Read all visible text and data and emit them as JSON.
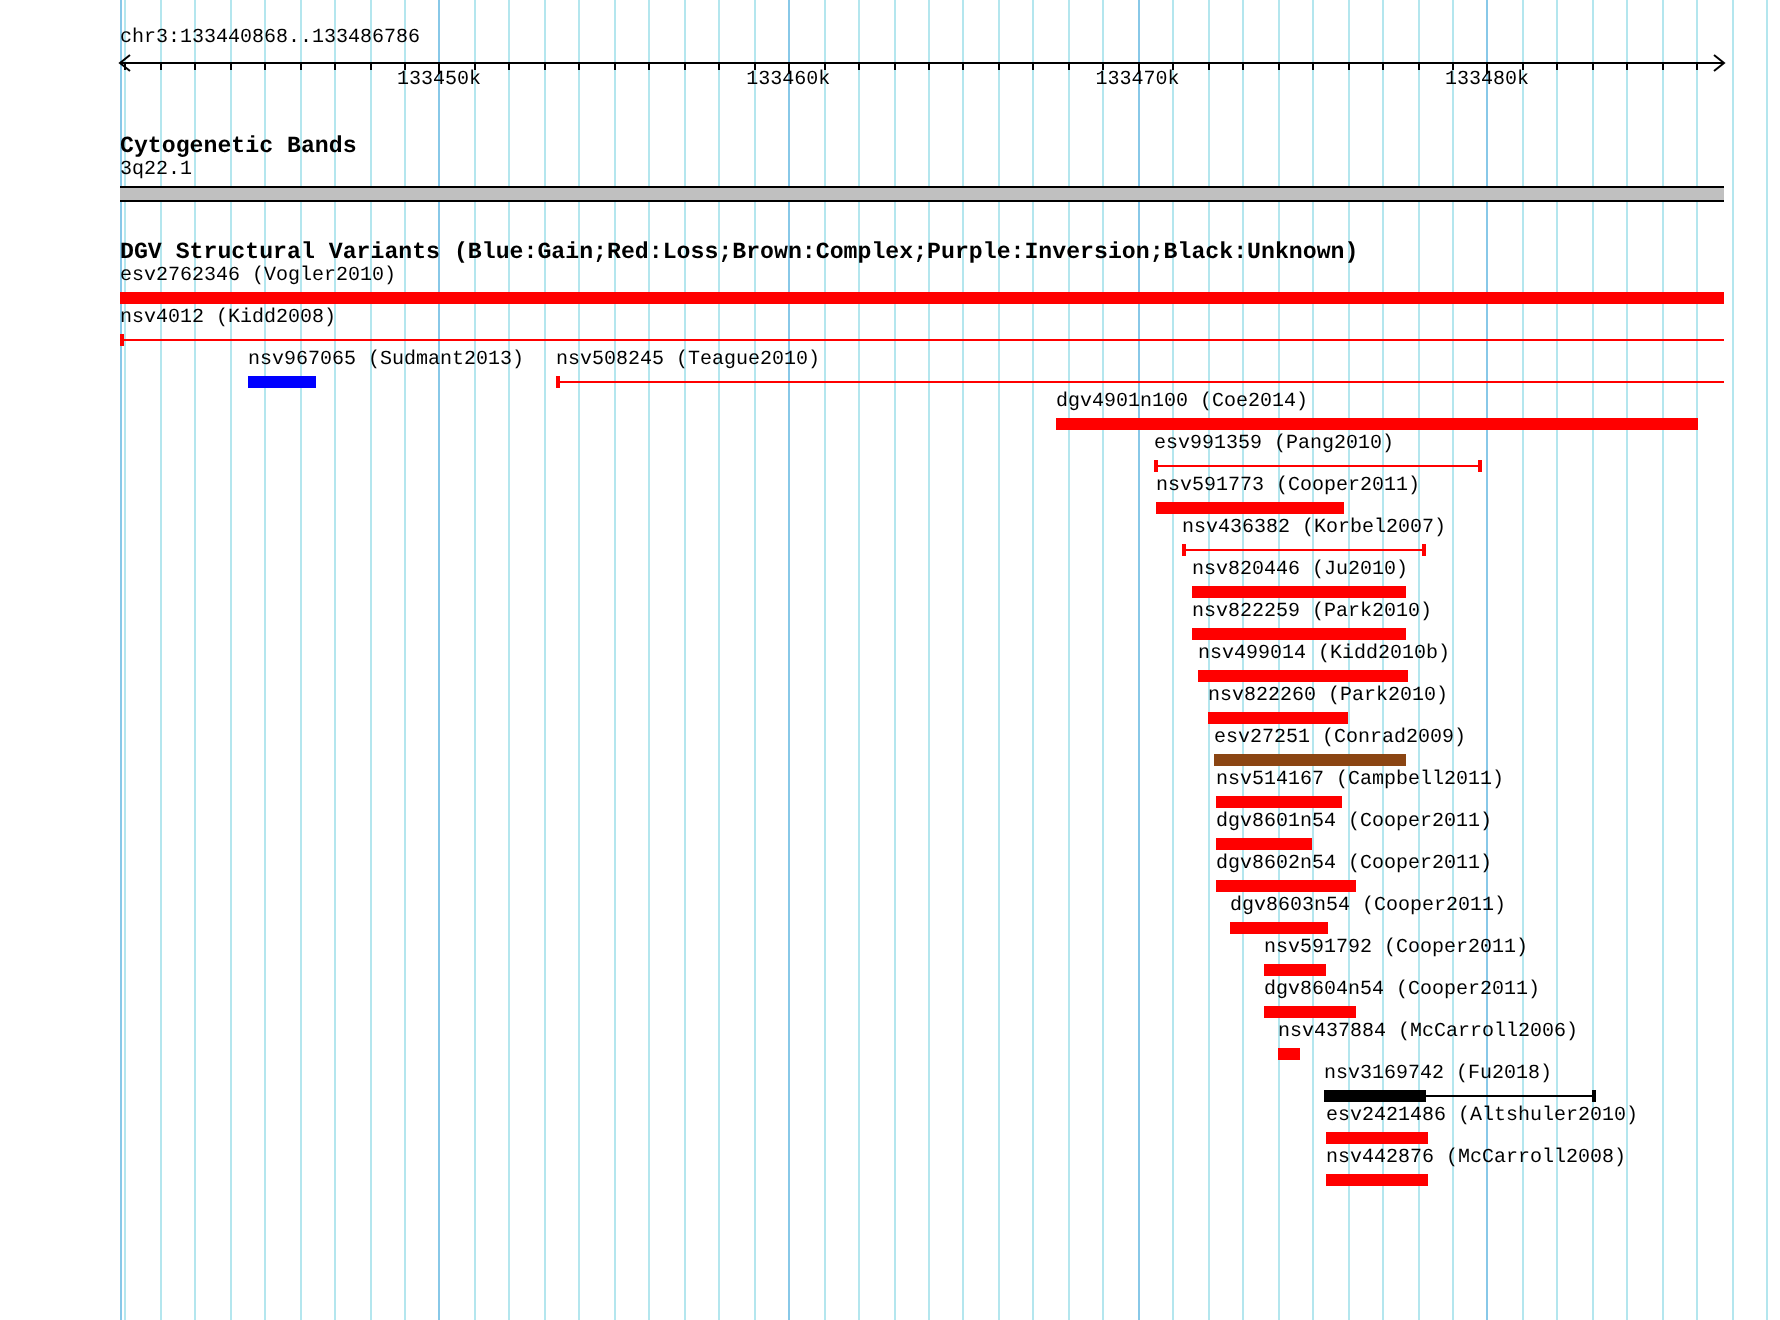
{
  "ruler": {
    "position": "chr3:133440868..133486786",
    "tick_labels": [
      "133450k",
      "133460k",
      "133470k",
      "133480k"
    ]
  },
  "cytoband_track": {
    "title": "Cytogenetic Bands",
    "band_label": "3q22.1"
  },
  "variant_track": {
    "title": "DGV Structural Variants (Blue:Gain;Red:Loss;Brown:Complex;Purple:Inversion;Black:Unknown)",
    "rows": [
      {
        "features": [
          {
            "label": "esv2762346 (Vogler2010)",
            "kind": "bar",
            "color": "#ff0000"
          }
        ]
      },
      {
        "features": [
          {
            "label": "nsv4012 (Kidd2008)",
            "kind": "span",
            "color": "#ff0000"
          }
        ]
      },
      {
        "features": [
          {
            "label": "nsv967065 (Sudmant2013)",
            "kind": "bar",
            "color": "#0000ff"
          },
          {
            "label": "nsv508245 (Teague2010)",
            "kind": "span",
            "color": "#ff0000"
          }
        ]
      },
      {
        "features": [
          {
            "label": "dgv4901n100 (Coe2014)",
            "kind": "bar",
            "color": "#ff0000"
          }
        ]
      },
      {
        "features": [
          {
            "label": "esv991359 (Pang2010)",
            "kind": "span",
            "color": "#ff0000"
          }
        ]
      },
      {
        "features": [
          {
            "label": "nsv591773 (Cooper2011)",
            "kind": "bar",
            "color": "#ff0000"
          }
        ]
      },
      {
        "features": [
          {
            "label": "nsv436382 (Korbel2007)",
            "kind": "span",
            "color": "#ff0000"
          }
        ]
      },
      {
        "features": [
          {
            "label": "nsv820446 (Ju2010)",
            "kind": "bar",
            "color": "#ff0000"
          }
        ]
      },
      {
        "features": [
          {
            "label": "nsv822259 (Park2010)",
            "kind": "bar",
            "color": "#ff0000"
          }
        ]
      },
      {
        "features": [
          {
            "label": "nsv499014 (Kidd2010b)",
            "kind": "bar",
            "color": "#ff0000"
          }
        ]
      },
      {
        "features": [
          {
            "label": "nsv822260 (Park2010)",
            "kind": "bar",
            "color": "#ff0000"
          }
        ]
      },
      {
        "features": [
          {
            "label": "esv27251 (Conrad2009)",
            "kind": "bar",
            "color": "#8b4513"
          }
        ]
      },
      {
        "features": [
          {
            "label": "nsv514167 (Campbell2011)",
            "kind": "bar",
            "color": "#ff0000"
          }
        ]
      },
      {
        "features": [
          {
            "label": "dgv8601n54 (Cooper2011)",
            "kind": "bar",
            "color": "#ff0000"
          }
        ]
      },
      {
        "features": [
          {
            "label": "dgv8602n54 (Cooper2011)",
            "kind": "bar",
            "color": "#ff0000"
          }
        ]
      },
      {
        "features": [
          {
            "label": "dgv8603n54 (Cooper2011)",
            "kind": "bar",
            "color": "#ff0000"
          }
        ]
      },
      {
        "features": [
          {
            "label": "nsv591792 (Cooper2011)",
            "kind": "bar",
            "color": "#ff0000"
          }
        ]
      },
      {
        "features": [
          {
            "label": "dgv8604n54 (Cooper2011)",
            "kind": "bar",
            "color": "#ff0000"
          }
        ]
      },
      {
        "features": [
          {
            "label": "nsv437884 (McCarroll2006)",
            "kind": "bar",
            "color": "#ff0000"
          }
        ]
      },
      {
        "features": [
          {
            "label": "nsv3169742 (Fu2018)",
            "kind": "bar-span",
            "color": "#000000"
          }
        ]
      },
      {
        "features": [
          {
            "label": "esv2421486 (Altshuler2010)",
            "kind": "bar",
            "color": "#ff0000"
          }
        ]
      },
      {
        "features": [
          {
            "label": "nsv442876 (McCarroll2008)",
            "kind": "bar",
            "color": "#ff0000"
          }
        ]
      }
    ]
  }
}
